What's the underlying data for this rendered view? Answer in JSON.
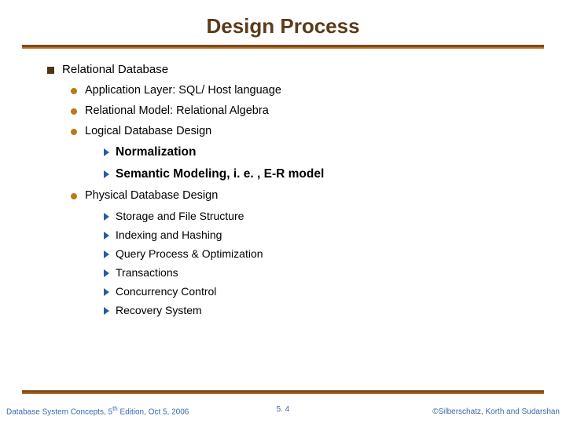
{
  "title": "Design Process",
  "main": {
    "text": "Relational Database",
    "items": [
      {
        "text": "Application Layer: SQL/ Host language"
      },
      {
        "text": "Relational Model: Relational Algebra"
      },
      {
        "text": "Logical Database Design",
        "sub_bold": [
          "Normalization",
          "Semantic Modeling, i. e. , E-R model"
        ]
      },
      {
        "text": "Physical Database Design",
        "sub": [
          "Storage and File Structure",
          "Indexing and Hashing",
          "Query Process & Optimization",
          "Transactions",
          "Concurrency Control",
          "Recovery System"
        ]
      }
    ]
  },
  "footer": {
    "left_prefix": "Database System Concepts, 5",
    "left_sup": "th",
    "left_suffix": " Edition, Oct 5,  2006",
    "center": "5. 4",
    "right": "©Silberschatz, Korth and Sudarshan"
  }
}
